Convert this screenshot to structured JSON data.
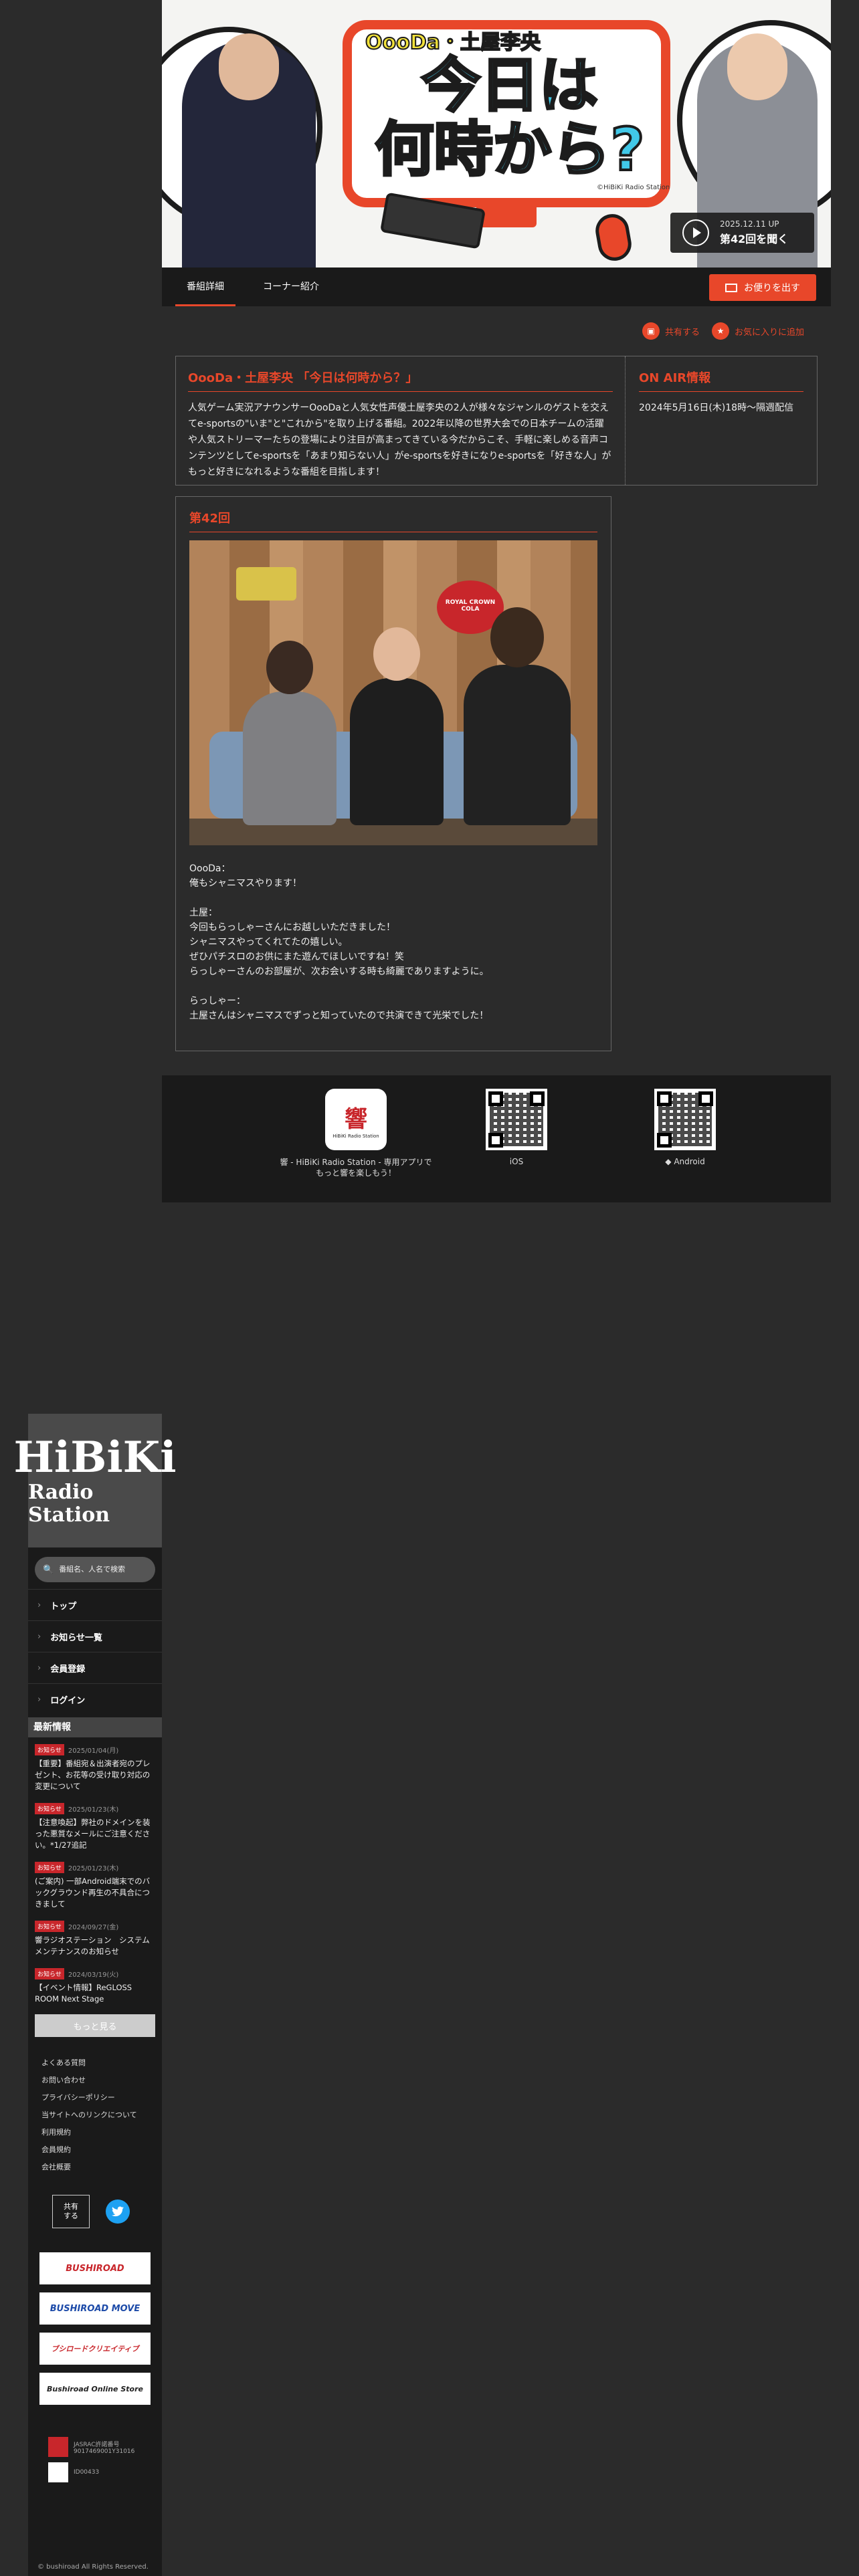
{
  "hero": {
    "show_logo_text": "OooDa・土屋李央",
    "title_line1": "今日は",
    "title_line2": "何時から?",
    "credit": "©HiBiKi Radio Station",
    "listen_date": "2025.12.11 UP",
    "listen_label": "第42回を聞く"
  },
  "tabs": [
    "番組詳細",
    "コーナー紹介"
  ],
  "mail_button": "お便りを出す",
  "share": {
    "share_label": "共有する",
    "favorite_label": "お気に入りに追加"
  },
  "program": {
    "title": "OooDa・土屋李央 「今日は何時から？」",
    "description": "人気ゲーム実況アナウンサーOooDaと人気女性声優土屋李央の2人が様々なジャンルのゲストを交えてe-sportsの\"いま\"と\"これから\"を取り上げる番組。2022年以降の世界大会での日本チームの活躍や人気ストリーマーたちの登場により注目が高まってきている今だからこそ、手軽に楽しめる音声コンテンツとしてe-sportsを「あまり知らない人」がe-sportsを好きになりe-sportsを「好きな人」がもっと好きになれるような番組を目指します！"
  },
  "onair": {
    "title": "ON AIR情報",
    "text": "2024年5月16日(木)18時〜隔週配信"
  },
  "episode": {
    "title": "第42回",
    "text": "OooDa：\n俺もシャニマスやります！\n\n土屋：\n今回もらっしゃーさんにお越しいただきました！\nシャニマスやってくれてたの嬉しい。\nぜひパチスロのお供にまた遊んでほしいですね！笑\nらっしゃーさんのお部屋が、次お会いする時も綺麗でありますように。\n\nらっしゃー：\n土屋さんはシャニマスでずっと知っていたので共演できて光栄でした！",
    "photo_sign": "ROYAL CROWN COLA"
  },
  "apps": {
    "app_icon_text": "響",
    "app_icon_sub": "HiBiKi Radio Station",
    "app_label": "響 - HiBiKi Radio Station - 専用アプリで\nもっと響を楽しもう！",
    "ios_label": " iOS",
    "android_label": "◆ Android"
  },
  "sidebar": {
    "logo_line1": "HiBiKi",
    "logo_line2": "Radio Station",
    "search_placeholder": "番組名、人名で検索",
    "nav": [
      "トップ",
      "お知らせ一覧",
      "会員登録",
      "ログイン"
    ],
    "news_heading": "最新情報",
    "news": [
      {
        "badge": "お知らせ",
        "date": "2025/01/04(月)",
        "title": "【重要】番組宛＆出演者宛のプレゼント、お花等の受け取り対応の変更について"
      },
      {
        "badge": "お知らせ",
        "date": "2025/01/23(木)",
        "title": "【注意喚起】弊社のドメインを装った悪質なメールにご注意ください。*1/27追記"
      },
      {
        "badge": "お知らせ",
        "date": "2025/01/23(木)",
        "title": "(ご案内) 一部Android端末でのバックグラウンド再生の不具合につきまして"
      },
      {
        "badge": "お知らせ",
        "date": "2024/09/27(金)",
        "title": "響ラジオステーション　システムメンテナンスのお知らせ"
      },
      {
        "badge": "お知らせ",
        "date": "2024/03/19(火)",
        "title": "【イベント情報】ReGLOSS ROOM Next Stage"
      }
    ],
    "more_label": "もっと見る",
    "footer_links": [
      "よくある質問",
      "お問い合わせ",
      "プライバシーポリシー",
      "当サイトへのリンクについて",
      "利用規約",
      "会員規約",
      "会社概要"
    ],
    "share_label": "共有\nする",
    "banners": [
      "BUSHIROAD",
      "BUSHIROAD MOVE",
      "ブシロードクリエイティブ",
      "Bushiroad Online Store"
    ],
    "license1": "JASRAC許諾番号\n9017469001Y31016",
    "license2": "ID00433",
    "copyright": "© bushiroad All Rights Reserved."
  }
}
